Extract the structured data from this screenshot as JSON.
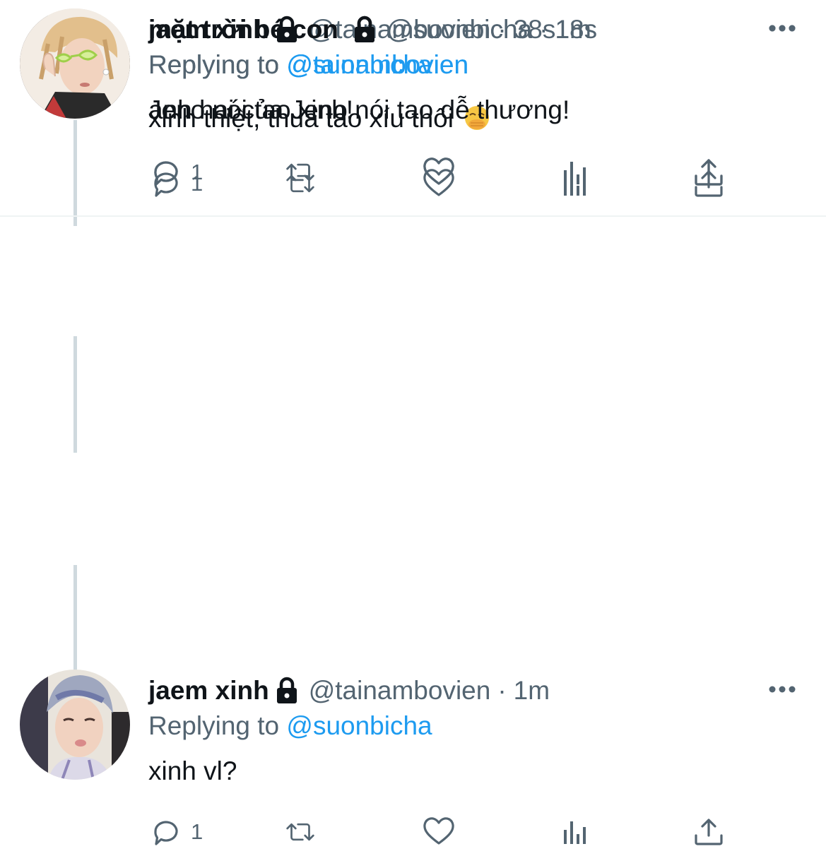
{
  "colors": {
    "link": "#1d9bf0",
    "secondary_text": "#536471",
    "primary_text": "#0f1419",
    "thread_line": "#cfd9de"
  },
  "tweets": [
    {
      "display_name": "jaem xinh",
      "handle": "@tainambovien",
      "separator": "·",
      "time": "1m",
      "replying_label": "Replying to",
      "replying_to": "@suonbicha",
      "text": "xinh vl?",
      "reply_count": "1",
      "avatar": "avatar-jaem",
      "has_emoji": false
    },
    {
      "display_name": "mặt trời bé con",
      "handle": "@suonbicha",
      "separator": "·",
      "time": "1m",
      "replying_label": "Replying to",
      "replying_to": "@tainambovien",
      "text": "xinh thiệt, thua tao xíu thôi",
      "reply_count": "1",
      "avatar": "avatar-suon",
      "has_emoji": true,
      "emoji": "face-with-hand-over-mouth"
    },
    {
      "display_name": "jaem xinh",
      "handle": "@tainambovien",
      "separator": "·",
      "time": "38s",
      "replying_label": "Replying to",
      "replying_to": "@suonbicha",
      "text": "Jeno nói tao xinh!",
      "reply_count": "1",
      "avatar": "avatar-jaem",
      "has_emoji": false
    },
    {
      "display_name": "mặt trời bé con",
      "handle": "@suonbicha",
      "separator": "·",
      "time": "18s",
      "replying_label": "Replying to",
      "replying_to": "@tainambovien",
      "text": "anh hai của Jeno nói tao dễ thương!",
      "reply_count": "",
      "avatar": "avatar-suon",
      "has_emoji": false
    }
  ]
}
